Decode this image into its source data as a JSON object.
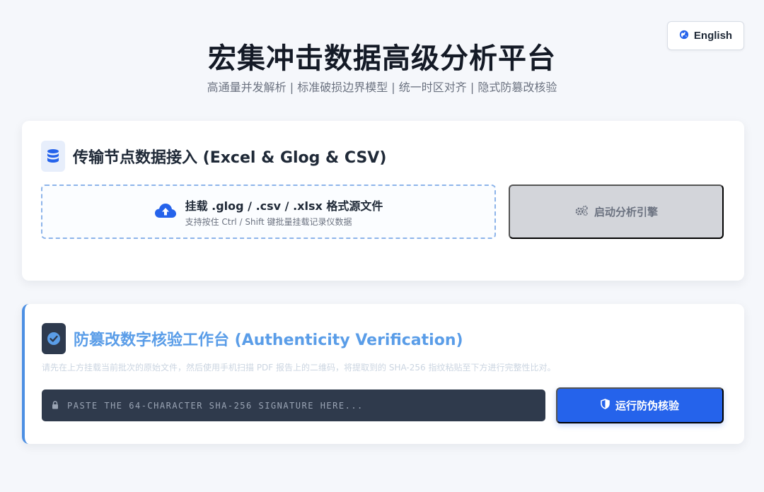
{
  "header": {
    "language_button": "English",
    "title": "宏集冲击数据高级分析平台",
    "subtitle": "高通量并发解析 | 标准破损边界模型 | 统一时区对齐 | 隐式防篡改核验"
  },
  "ingest": {
    "title": "传输节点数据接入 (Excel & Glog & CSV)",
    "upload_main": "挂载 .glog / .csv / .xlsx 格式源文件",
    "upload_sub": "支持按住 Ctrl / Shift 键批量挂载记录仪数据",
    "run_button": "启动分析引擎"
  },
  "verify": {
    "title": "防篡改数字核验工作台 (Authenticity Verification)",
    "note": "请先在上方挂载当前批次的原始文件，然后使用手机扫描 PDF 报告上的二维码，将提取到的 SHA-256 指纹粘贴至下方进行完整性比对。",
    "input_placeholder": "PASTE THE 64-CHARACTER SHA-256 SIGNATURE HERE...",
    "button": "运行防伪核验"
  },
  "icons": {
    "language": "globe-icon",
    "ingest": "database-icon",
    "upload": "cloud-upload-icon",
    "run": "gears-icon",
    "verify": "check-circle-icon",
    "lock": "lock-icon",
    "shield": "shield-icon"
  },
  "colors": {
    "primary": "#2563eb",
    "accent": "#4c8fe3",
    "disabled_button": "#d3d5da",
    "input_background": "#2f3a4c"
  }
}
